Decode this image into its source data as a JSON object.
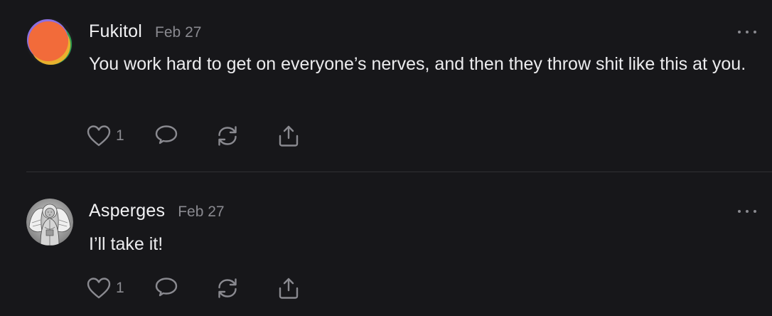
{
  "posts": [
    {
      "author": "Fukitol",
      "date": "Feb 27",
      "text": "You work hard to get on everyone’s nerves, and then they throw shit like this at you.",
      "like_count": "1",
      "avatar": "orange-colorful-circle-avatar"
    },
    {
      "author": "Asperges",
      "date": "Feb 27",
      "text": "I’ll take it!",
      "like_count": "1",
      "avatar": "grayscale-angel-icon-avatar"
    }
  ],
  "icons": {
    "like": "heart-icon",
    "reply": "speech-bubble-icon",
    "repost": "repost-arrows-icon",
    "share": "share-upload-icon",
    "more": "ellipsis-icon"
  },
  "colors": {
    "background": "#17171a",
    "text": "#ececee",
    "muted": "#8a8a90",
    "divider": "#303034",
    "avatar_orange": "#f26b3a"
  }
}
